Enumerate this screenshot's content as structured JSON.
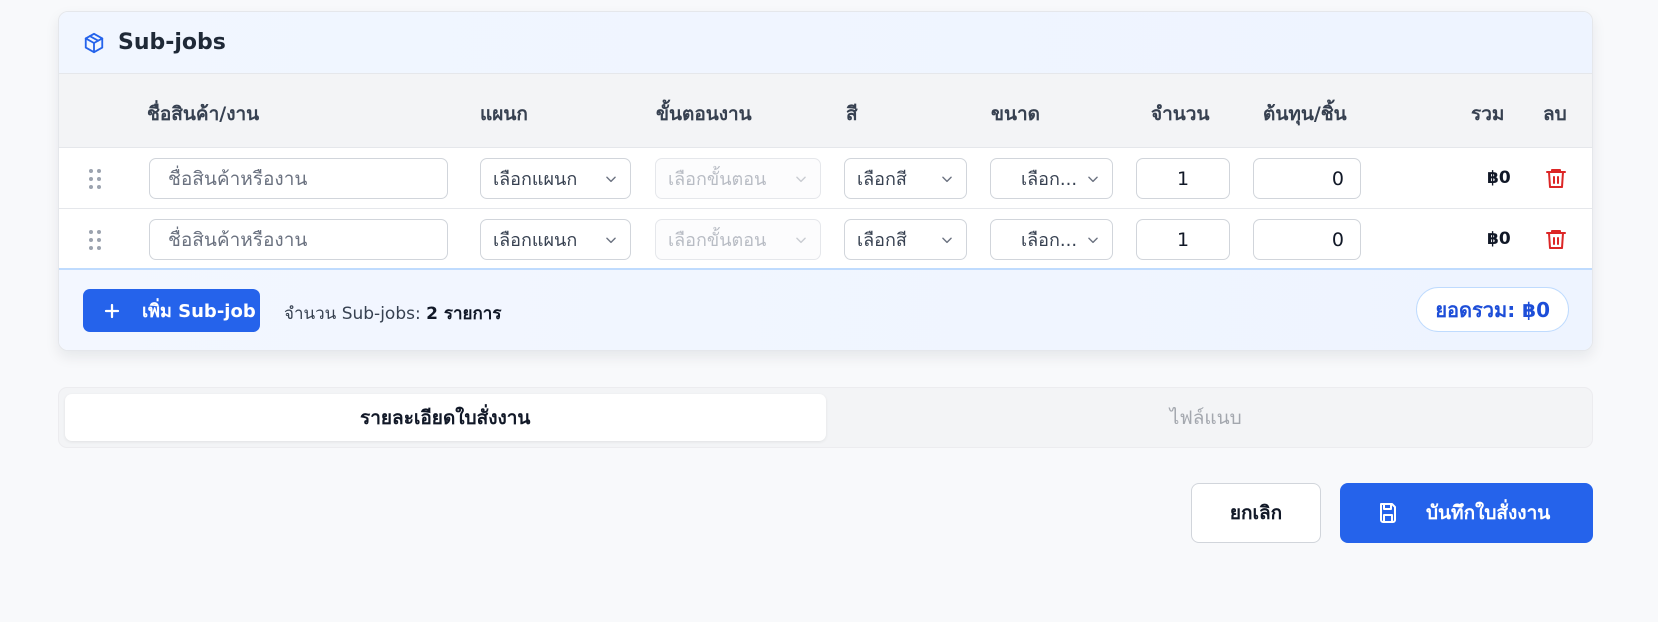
{
  "section": {
    "title": "Sub-jobs",
    "icon": "package-icon"
  },
  "table": {
    "columns": [
      "ชื่อสินค้า/งาน",
      "แผนก",
      "ขั้นตอนงาน",
      "สี",
      "ขนาด",
      "จำนวน",
      "ต้นทุน/ชิ้น",
      "รวม",
      "ลบ"
    ],
    "rows": [
      {
        "name_placeholder": "ชื่อสินค้าหรืองาน",
        "department": "เลือกแผนก",
        "step": "เลือกขั้นตอน",
        "color": "เลือกสี",
        "size": "เลือก...",
        "quantity": "1",
        "unit_cost": "0",
        "total": "฿0"
      },
      {
        "name_placeholder": "ชื่อสินค้าหรืองาน",
        "department": "เลือกแผนก",
        "step": "เลือกขั้นตอน",
        "color": "เลือกสี",
        "size": "เลือก...",
        "quantity": "1",
        "unit_cost": "0",
        "total": "฿0"
      }
    ]
  },
  "footer": {
    "add_button": "เพิ่ม Sub-job",
    "count_label": "จำนวน Sub-jobs:",
    "count_value": "2 รายการ",
    "grand_total": "ยอดรวม: ฿0"
  },
  "tabs": [
    {
      "label": "รายละเอียดใบสั่งงาน",
      "active": true
    },
    {
      "label": "ไฟล์แนบ",
      "active": false
    }
  ],
  "actions": {
    "cancel": "ยกเลิก",
    "save": "บันทึกใบสั่งงาน"
  },
  "colors": {
    "accent": "#2563eb",
    "danger": "#dc2626"
  }
}
